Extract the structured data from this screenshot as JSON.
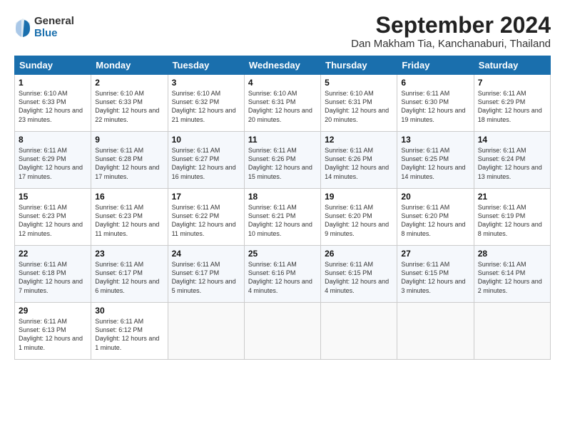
{
  "header": {
    "logo_general": "General",
    "logo_blue": "Blue",
    "month_title": "September 2024",
    "location": "Dan Makham Tia, Kanchanaburi, Thailand"
  },
  "days_of_week": [
    "Sunday",
    "Monday",
    "Tuesday",
    "Wednesday",
    "Thursday",
    "Friday",
    "Saturday"
  ],
  "weeks": [
    [
      {
        "day": "1",
        "sunrise": "6:10 AM",
        "sunset": "6:33 PM",
        "daylight": "12 hours and 23 minutes."
      },
      {
        "day": "2",
        "sunrise": "6:10 AM",
        "sunset": "6:33 PM",
        "daylight": "12 hours and 22 minutes."
      },
      {
        "day": "3",
        "sunrise": "6:10 AM",
        "sunset": "6:32 PM",
        "daylight": "12 hours and 21 minutes."
      },
      {
        "day": "4",
        "sunrise": "6:10 AM",
        "sunset": "6:31 PM",
        "daylight": "12 hours and 20 minutes."
      },
      {
        "day": "5",
        "sunrise": "6:10 AM",
        "sunset": "6:31 PM",
        "daylight": "12 hours and 20 minutes."
      },
      {
        "day": "6",
        "sunrise": "6:11 AM",
        "sunset": "6:30 PM",
        "daylight": "12 hours and 19 minutes."
      },
      {
        "day": "7",
        "sunrise": "6:11 AM",
        "sunset": "6:29 PM",
        "daylight": "12 hours and 18 minutes."
      }
    ],
    [
      {
        "day": "8",
        "sunrise": "6:11 AM",
        "sunset": "6:29 PM",
        "daylight": "12 hours and 17 minutes."
      },
      {
        "day": "9",
        "sunrise": "6:11 AM",
        "sunset": "6:28 PM",
        "daylight": "12 hours and 17 minutes."
      },
      {
        "day": "10",
        "sunrise": "6:11 AM",
        "sunset": "6:27 PM",
        "daylight": "12 hours and 16 minutes."
      },
      {
        "day": "11",
        "sunrise": "6:11 AM",
        "sunset": "6:26 PM",
        "daylight": "12 hours and 15 minutes."
      },
      {
        "day": "12",
        "sunrise": "6:11 AM",
        "sunset": "6:26 PM",
        "daylight": "12 hours and 14 minutes."
      },
      {
        "day": "13",
        "sunrise": "6:11 AM",
        "sunset": "6:25 PM",
        "daylight": "12 hours and 14 minutes."
      },
      {
        "day": "14",
        "sunrise": "6:11 AM",
        "sunset": "6:24 PM",
        "daylight": "12 hours and 13 minutes."
      }
    ],
    [
      {
        "day": "15",
        "sunrise": "6:11 AM",
        "sunset": "6:23 PM",
        "daylight": "12 hours and 12 minutes."
      },
      {
        "day": "16",
        "sunrise": "6:11 AM",
        "sunset": "6:23 PM",
        "daylight": "12 hours and 11 minutes."
      },
      {
        "day": "17",
        "sunrise": "6:11 AM",
        "sunset": "6:22 PM",
        "daylight": "12 hours and 11 minutes."
      },
      {
        "day": "18",
        "sunrise": "6:11 AM",
        "sunset": "6:21 PM",
        "daylight": "12 hours and 10 minutes."
      },
      {
        "day": "19",
        "sunrise": "6:11 AM",
        "sunset": "6:20 PM",
        "daylight": "12 hours and 9 minutes."
      },
      {
        "day": "20",
        "sunrise": "6:11 AM",
        "sunset": "6:20 PM",
        "daylight": "12 hours and 8 minutes."
      },
      {
        "day": "21",
        "sunrise": "6:11 AM",
        "sunset": "6:19 PM",
        "daylight": "12 hours and 8 minutes."
      }
    ],
    [
      {
        "day": "22",
        "sunrise": "6:11 AM",
        "sunset": "6:18 PM",
        "daylight": "12 hours and 7 minutes."
      },
      {
        "day": "23",
        "sunrise": "6:11 AM",
        "sunset": "6:17 PM",
        "daylight": "12 hours and 6 minutes."
      },
      {
        "day": "24",
        "sunrise": "6:11 AM",
        "sunset": "6:17 PM",
        "daylight": "12 hours and 5 minutes."
      },
      {
        "day": "25",
        "sunrise": "6:11 AM",
        "sunset": "6:16 PM",
        "daylight": "12 hours and 4 minutes."
      },
      {
        "day": "26",
        "sunrise": "6:11 AM",
        "sunset": "6:15 PM",
        "daylight": "12 hours and 4 minutes."
      },
      {
        "day": "27",
        "sunrise": "6:11 AM",
        "sunset": "6:15 PM",
        "daylight": "12 hours and 3 minutes."
      },
      {
        "day": "28",
        "sunrise": "6:11 AM",
        "sunset": "6:14 PM",
        "daylight": "12 hours and 2 minutes."
      }
    ],
    [
      {
        "day": "29",
        "sunrise": "6:11 AM",
        "sunset": "6:13 PM",
        "daylight": "12 hours and 1 minute."
      },
      {
        "day": "30",
        "sunrise": "6:11 AM",
        "sunset": "6:12 PM",
        "daylight": "12 hours and 1 minute."
      },
      null,
      null,
      null,
      null,
      null
    ]
  ]
}
